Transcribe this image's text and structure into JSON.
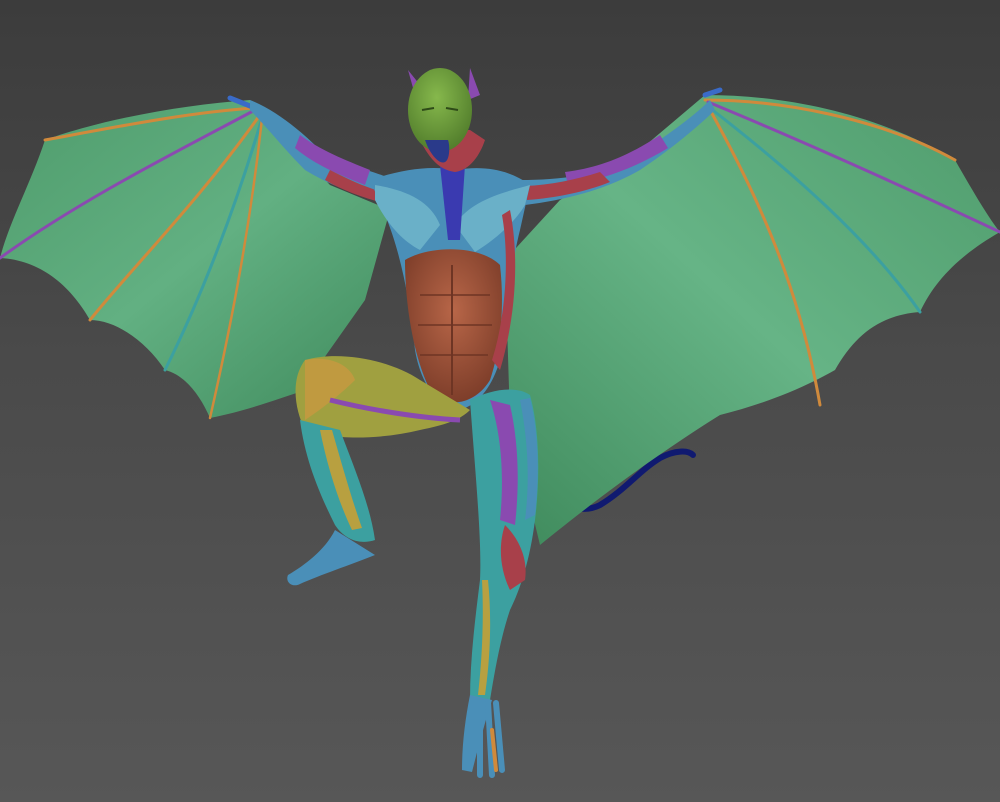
{
  "scene": {
    "subject_icon": "winged-creature-anatomy-sculpt",
    "colors": {
      "background_top": "#3c3c3c",
      "background_bottom": "#575757",
      "wing_membrane": "#5aa878",
      "wing_membrane_dark": "#3f8a5c",
      "wing_bone_orange": "#d08a3c",
      "wing_bone_blue": "#3a6bc8",
      "skin_head": "#6a9a3a",
      "muscle_blue": "#4a8fb8",
      "muscle_red": "#a8404a",
      "muscle_purple": "#8a4ab0",
      "abdomen_brown": "#a0553a",
      "tendon_yellow": "#b8a040",
      "teal": "#3ca0a0",
      "tail_navy": "#101a70"
    }
  }
}
